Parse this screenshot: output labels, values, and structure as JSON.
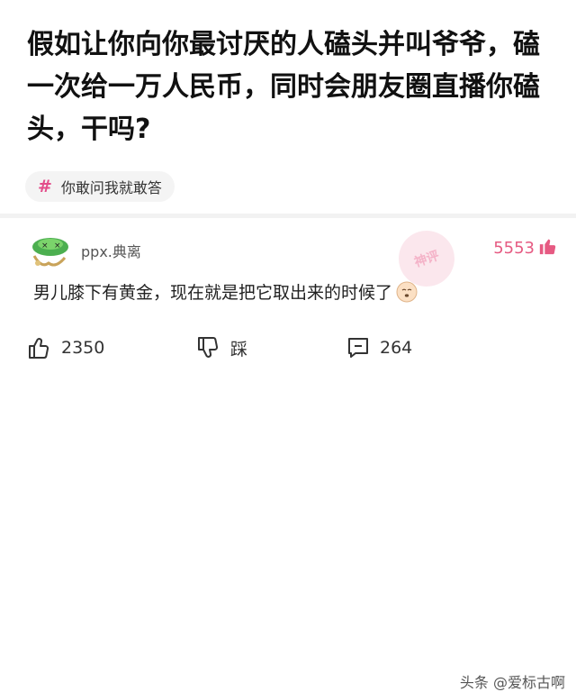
{
  "question": {
    "title": "假如让你向你最讨厌的人磕头并叫爷爷，磕一次给一万人民币，同时会朋友圈直播你磕头，干吗?"
  },
  "topic": {
    "icon": "hash-icon",
    "label": "你敢问我就敢答"
  },
  "comment": {
    "username": "ppx.典离",
    "stamp_text": "神评",
    "like_count": "5553",
    "text": "男儿膝下有黄金，现在就是把它取出来的时候了",
    "emoji": "smirk-face-icon"
  },
  "actions": {
    "like_count": "2350",
    "dislike_label": "踩",
    "comment_count": "264"
  },
  "watermark": "头条 @爱标古啊",
  "colors": {
    "accent": "#e65a82",
    "hash": "#e34d8a",
    "topic_bg": "#f4f4f4"
  }
}
